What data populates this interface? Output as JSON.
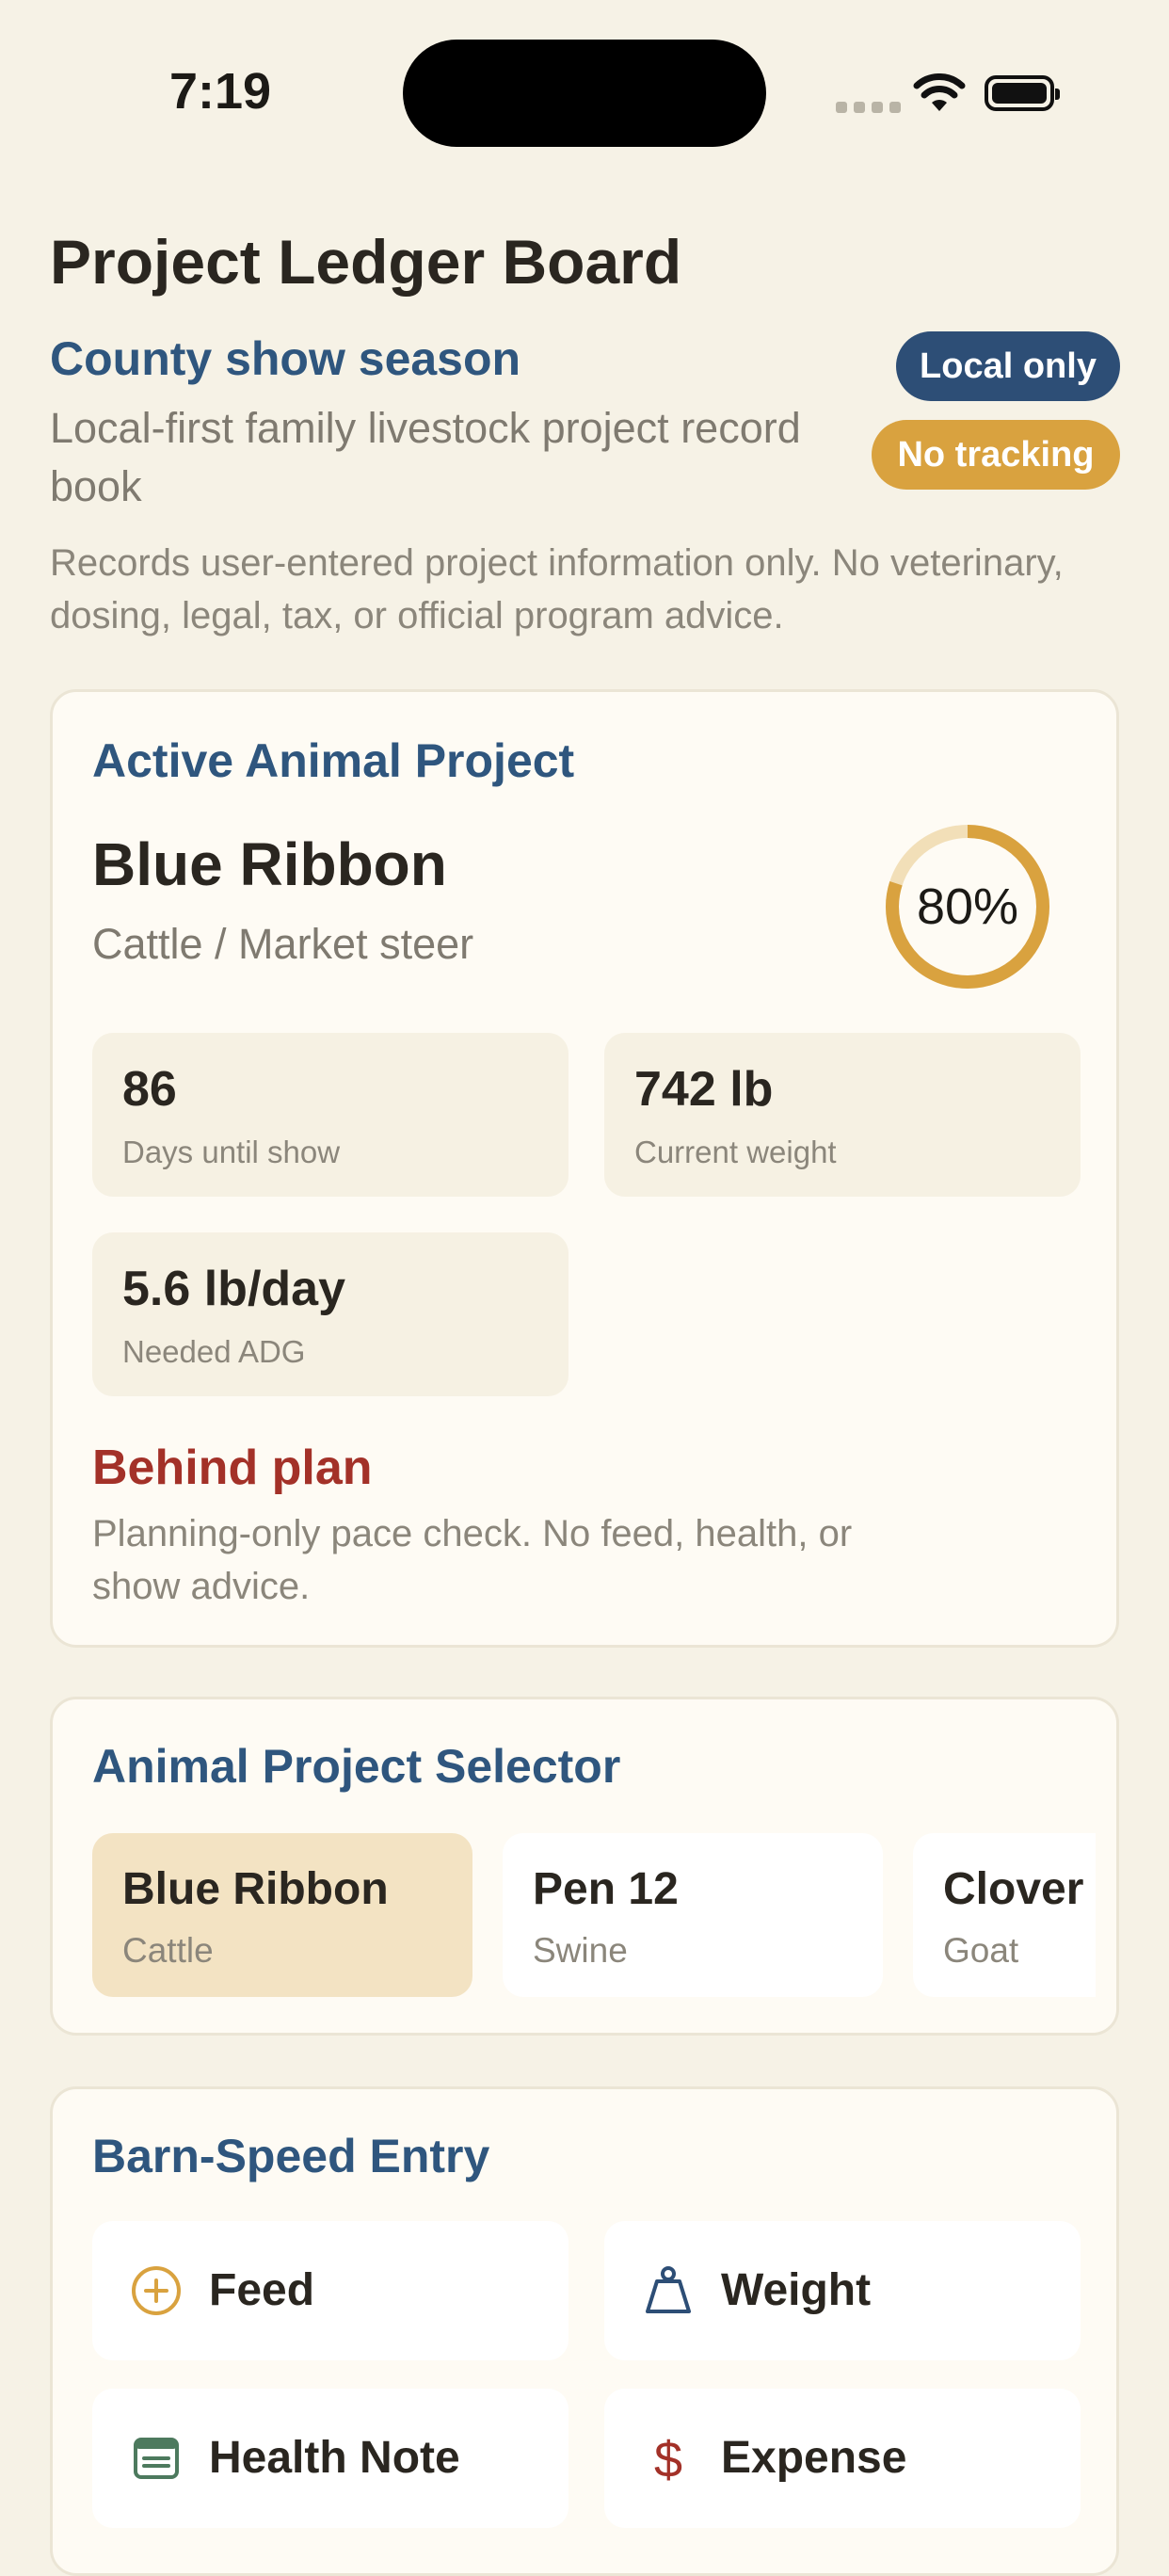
{
  "status_bar": {
    "time": "7:19"
  },
  "header": {
    "title": "Project Ledger Board",
    "season": "County show season",
    "tagline": "Local-first family livestock project record book",
    "badges": {
      "local": "Local only",
      "tracking": "No tracking"
    },
    "disclaimer": "Records user-entered project information only. No veterinary, dosing, legal, tax, or official program advice."
  },
  "active_project": {
    "section_title": "Active Animal Project",
    "name": "Blue Ribbon",
    "type": "Cattle / Market steer",
    "progress_label": "80%",
    "progress_fraction": 0.8,
    "stats": [
      {
        "value": "86",
        "label": "Days until show"
      },
      {
        "value": "742 lb",
        "label": "Current weight"
      },
      {
        "value": "5.6 lb/day",
        "label": "Needed ADG"
      }
    ],
    "pace_status": "Behind plan",
    "pace_note": "Planning-only pace check. No feed, health, or show advice."
  },
  "selector": {
    "section_title": "Animal Project Selector",
    "projects": [
      {
        "name": "Blue Ribbon",
        "species": "Cattle"
      },
      {
        "name": "Pen 12",
        "species": "Swine"
      },
      {
        "name": "Clover",
        "species": "Goat"
      }
    ]
  },
  "entry": {
    "section_title": "Barn-Speed Entry",
    "buttons": [
      {
        "label": "Feed",
        "icon": "plus-circle-icon"
      },
      {
        "label": "Weight",
        "icon": "scale-icon"
      },
      {
        "label": "Health Note",
        "icon": "note-icon"
      },
      {
        "label": "Expense",
        "icon": "dollar-icon"
      }
    ]
  },
  "colors": {
    "background": "#f6f2e6",
    "accent_blue": "#2d4e76",
    "accent_gold": "#d9a23f",
    "alert_red": "#a33128",
    "selected_chip": "#f3e3c3"
  }
}
